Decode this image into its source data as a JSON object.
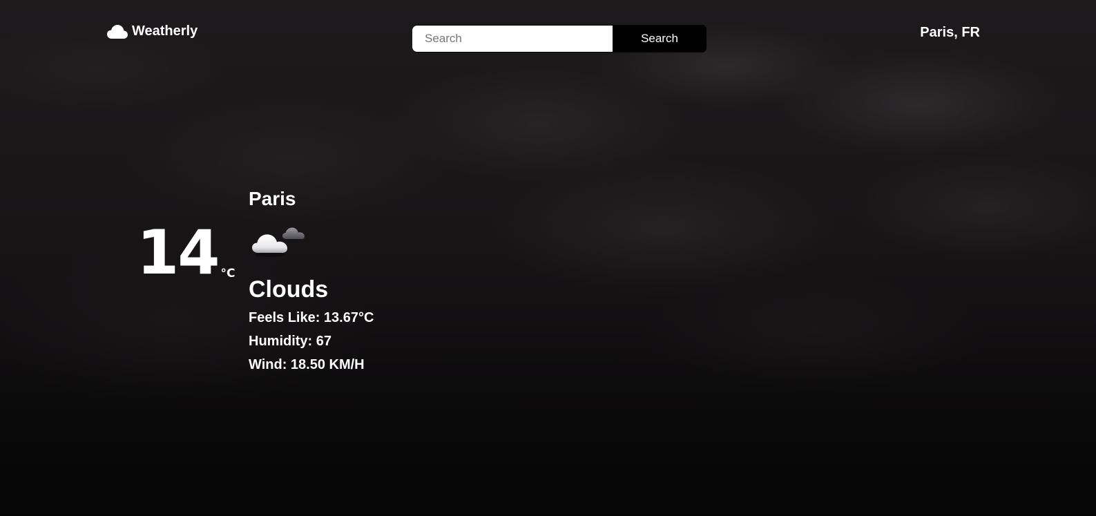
{
  "header": {
    "brand": "Weatherly",
    "brand_icon": "cloud-icon",
    "search": {
      "placeholder": "Search",
      "value": "",
      "button_label": "Search"
    },
    "location": "Paris, FR"
  },
  "current": {
    "temperature": "14",
    "unit": "°C",
    "city": "Paris",
    "icon": "partly-cloudy-icon",
    "condition": "Clouds",
    "metrics": [
      {
        "label": "Feels Like: 13.67°C"
      },
      {
        "label": "Humidity: 67"
      },
      {
        "label": "Wind: 18.50 KM/H"
      }
    ]
  },
  "colors": {
    "text": "#ffffff",
    "background": "#151214",
    "search_button": "#000000",
    "search_input": "#ffffff"
  }
}
